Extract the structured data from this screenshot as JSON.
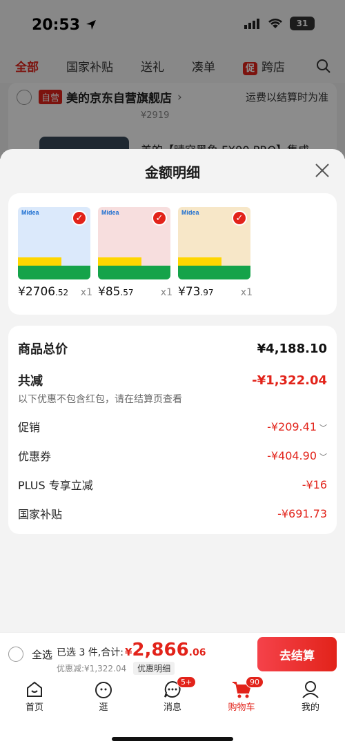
{
  "status": {
    "time": "20:53",
    "battery": "31"
  },
  "tabs": [
    {
      "label": "全部",
      "active": true
    },
    {
      "label": "国家补贴"
    },
    {
      "label": "送礼"
    },
    {
      "label": "凑单"
    },
    {
      "label": "跨店",
      "badge": "促"
    }
  ],
  "background_shop": {
    "badge": "自营",
    "name": "美的京东自营旗舰店",
    "arrow": "›",
    "shipping": "运费以结算时为准",
    "price": "¥2919",
    "product_title": "美的【晴空黑鱼 FX90 PRO】集成"
  },
  "sheet": {
    "title": "金额明细",
    "products": [
      {
        "price_int": "¥2706",
        "price_dec": ".52",
        "qty": "x1",
        "brand": "Midea",
        "color": "#dbe9fb"
      },
      {
        "price_int": "¥85",
        "price_dec": ".57",
        "qty": "x1",
        "brand": "Midea",
        "color": "#f7dede"
      },
      {
        "price_int": "¥73",
        "price_dec": ".97",
        "qty": "x1",
        "brand": "Midea",
        "color": "#f7e7c8"
      }
    ],
    "summary": {
      "total_label": "商品总价",
      "total_value": "¥4,188.10",
      "reduce_label": "共减",
      "reduce_value": "-¥1,322.04",
      "note": "以下优惠不包含红包，请在结算页查看",
      "rows": [
        {
          "label": "促销",
          "value": "-¥209.41"
        },
        {
          "label": "优惠券",
          "value": "-¥404.90"
        },
        {
          "label": "PLUS 专享立减",
          "value": "-¥16"
        },
        {
          "label": "国家补贴",
          "value": "-¥691.73"
        }
      ]
    }
  },
  "checkout": {
    "select_all": "全选",
    "selected_text": "已选 3 件,合计:",
    "total_currency": "¥",
    "total_int": "2,866",
    "total_dec": ".06",
    "discount_text": "优惠减:¥1,322.04",
    "detail_label": "优惠明细",
    "button": "去结算"
  },
  "nav": [
    {
      "label": "首页",
      "icon": "home-icon"
    },
    {
      "label": "逛",
      "icon": "browse-icon"
    },
    {
      "label": "消息",
      "icon": "message-icon",
      "badge": "5+"
    },
    {
      "label": "购物车",
      "icon": "cart-icon",
      "badge": "90",
      "active": true
    },
    {
      "label": "我的",
      "icon": "profile-icon"
    }
  ]
}
